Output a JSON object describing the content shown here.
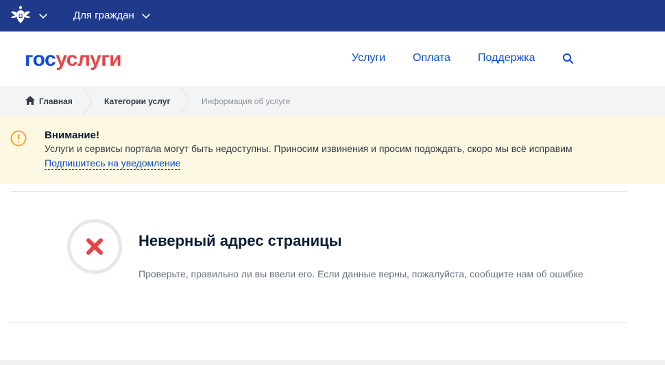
{
  "topbar": {
    "for_citizens_label": "Для граждан"
  },
  "header": {
    "logo_part1": "гос",
    "logo_part2": "услуги",
    "nav": {
      "services": "Услуги",
      "payment": "Оплата",
      "support": "Поддержка"
    }
  },
  "breadcrumbs": {
    "home": "Главная",
    "categories": "Категории услуг",
    "current": "Информация об услуге"
  },
  "alert": {
    "title": "Внимание!",
    "text": "Услуги и сервисы портала могут быть недоступны. Приносим извинения и просим подождать, скоро мы всё исправим",
    "link": "Подпишитесь на уведомление"
  },
  "error": {
    "title": "Неверный адрес страницы",
    "description": "Проверьте, правильно ли вы ввели его. Если данные верны, пожалуйста, сообщите нам об ошибке"
  },
  "icons": {
    "emblem": "russian-emblem-icon",
    "chevron": "chevron-down-icon",
    "search": "search-icon",
    "home": "home-icon",
    "warning": "exclamation-circle-icon",
    "error": "close-icon"
  },
  "colors": {
    "topbar": "#1f3a8a",
    "brand_blue": "#0d4cd3",
    "brand_red": "#e4444a",
    "alert_bg": "#fdf8e1",
    "alert_icon": "#f5a623",
    "error_x": "#e4444a"
  }
}
